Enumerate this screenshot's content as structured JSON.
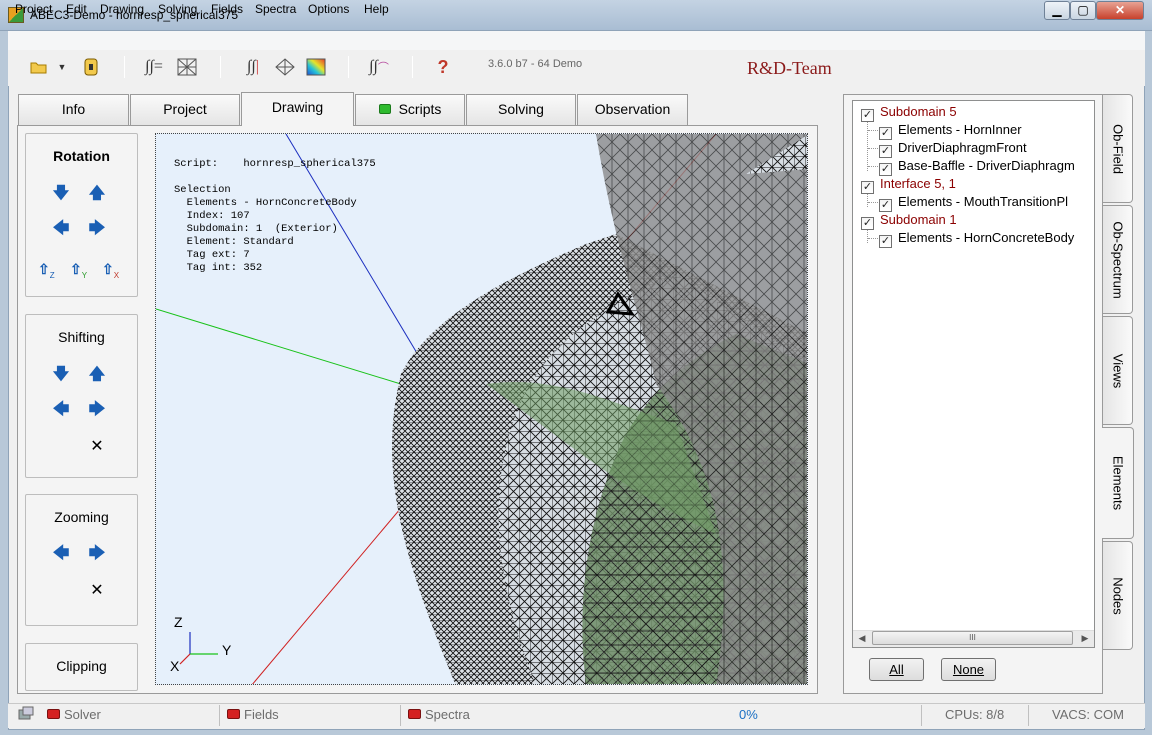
{
  "window": {
    "title": "ABEC3-Demo - hornresp_spherical375"
  },
  "menu": [
    "Project",
    "Edit",
    "Drawing",
    "Solving",
    "Fields",
    "Spectra",
    "Options",
    "Help"
  ],
  "toolbar": {
    "version": "3.6.0 b7 - 64 Demo",
    "brand": "R&D-Team"
  },
  "tabs": [
    "Info",
    "Project",
    "Drawing",
    "Scripts",
    "Solving",
    "Observation"
  ],
  "active_tab": "Drawing",
  "controls": {
    "rotation": "Rotation",
    "shifting": "Shifting",
    "zooming": "Zooming",
    "clipping": "Clipping",
    "axis_z": "Z",
    "axis_y": "Y",
    "axis_x": "X"
  },
  "viewport": {
    "script_label": "Script:",
    "script_name": "hornresp_spherical375",
    "selection_label": "Selection",
    "selection_lines": [
      "Elements - HornConcreteBody",
      "Index: 107",
      "Subdomain: 1  (Exterior)",
      "Element: Standard",
      "Tag ext: 7",
      "Tag int: 352"
    ],
    "triad": {
      "z": "Z",
      "y": "Y",
      "x": "X"
    }
  },
  "tree": [
    {
      "label": "Subdomain 5",
      "level": 0,
      "checked": true
    },
    {
      "label": "Elements - HornInner",
      "level": 1,
      "checked": true
    },
    {
      "label": "DriverDiaphragmFront",
      "level": 1,
      "checked": true
    },
    {
      "label": "Base-Baffle - DriverDiaphragm",
      "level": 1,
      "checked": true
    },
    {
      "label": "Interface 5, 1",
      "level": 0,
      "checked": true
    },
    {
      "label": "Elements - MouthTransitionPl",
      "level": 1,
      "checked": true
    },
    {
      "label": "Subdomain 1",
      "level": 0,
      "checked": true
    },
    {
      "label": "Elements - HornConcreteBody",
      "level": 1,
      "checked": true
    }
  ],
  "tree_scroll_thumb": "III",
  "buttons": {
    "all": "All",
    "none": "None"
  },
  "side_tabs": [
    "Ob-Field",
    "Ob-Spectrum",
    "Views",
    "Elements",
    "Nodes"
  ],
  "active_side_tab": "Elements",
  "status": {
    "solver": "Solver",
    "fields": "Fields",
    "spectra": "Spectra",
    "progress": "0%",
    "cpus": "CPUs: 8/8",
    "vacs": "VACS: COM"
  }
}
